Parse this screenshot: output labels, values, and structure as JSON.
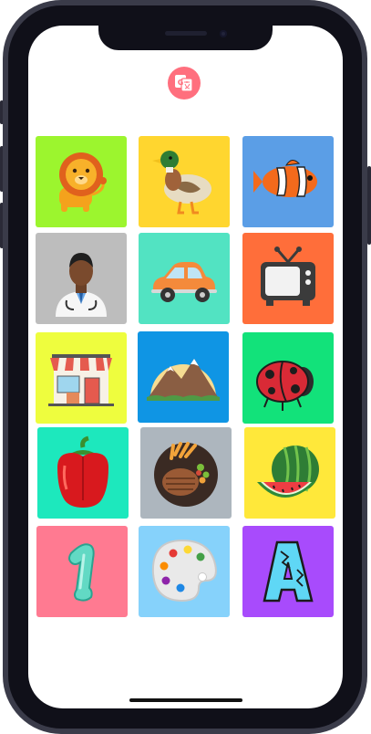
{
  "app": {
    "logo_icon": "translate-icon",
    "accent": "#ff6f7e"
  },
  "grid": {
    "tiles": [
      {
        "id": "lion",
        "icon": "lion-icon",
        "bg": "#9cf52e"
      },
      {
        "id": "duck",
        "icon": "duck-icon",
        "bg": "#ffd62f"
      },
      {
        "id": "fish",
        "icon": "clownfish-icon",
        "bg": "#5b9ee6"
      },
      {
        "id": "doctor",
        "icon": "doctor-icon",
        "bg": "#bdbdbd"
      },
      {
        "id": "car",
        "icon": "car-icon",
        "bg": "#52e3c2"
      },
      {
        "id": "tv",
        "icon": "tv-icon",
        "bg": "#ff6e3a"
      },
      {
        "id": "shop",
        "icon": "shop-icon",
        "bg": "#eefd3e"
      },
      {
        "id": "mountain",
        "icon": "mountain-icon",
        "bg": "#0f95e4"
      },
      {
        "id": "ladybug",
        "icon": "ladybug-icon",
        "bg": "#12e27a"
      },
      {
        "id": "pepper",
        "icon": "pepper-icon",
        "bg": "#1de8bd"
      },
      {
        "id": "steak",
        "icon": "steak-icon",
        "bg": "#adb6be"
      },
      {
        "id": "watermelon",
        "icon": "watermelon-icon",
        "bg": "#ffe83a"
      },
      {
        "id": "number-one",
        "icon": "number-one-icon",
        "bg": "#ff7a91"
      },
      {
        "id": "palette",
        "icon": "paint-palette-icon",
        "bg": "#86d2fb"
      },
      {
        "id": "letter-a",
        "icon": "letter-a-icon",
        "bg": "#a84bfc"
      }
    ]
  }
}
